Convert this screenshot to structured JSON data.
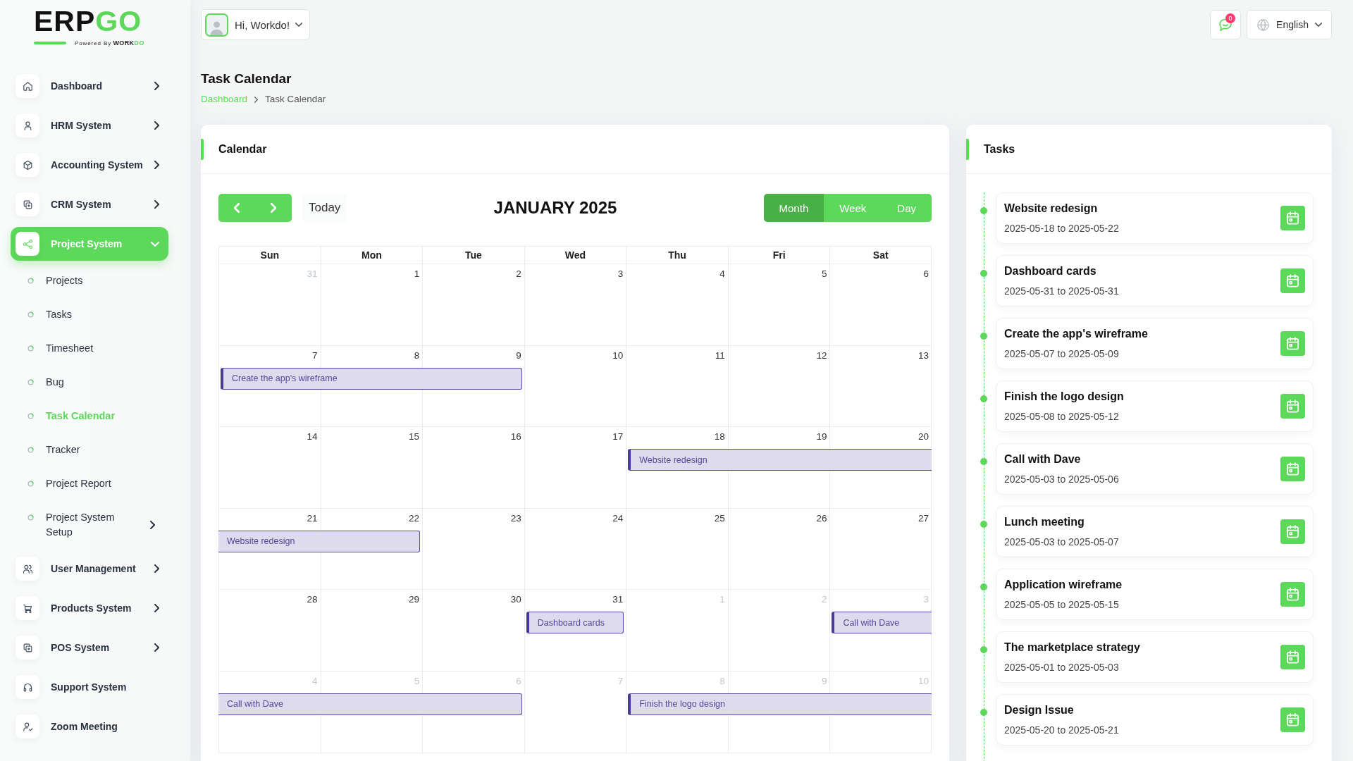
{
  "logo": {
    "name": "ERP",
    "name_accent": "GO",
    "tagline": "Powered By",
    "maker": "WORK",
    "maker_accent": "DO"
  },
  "header": {
    "user_menu": {
      "greeting": "Hi, Workdo!"
    },
    "notifications": {
      "count": "0"
    },
    "language": {
      "label": "English"
    }
  },
  "sidebar": {
    "items": [
      {
        "label": "Dashboard",
        "expanded": false,
        "selected": false
      },
      {
        "label": "HRM System",
        "expanded": false,
        "selected": false
      },
      {
        "label": "Accounting System",
        "expanded": false,
        "selected": false
      },
      {
        "label": "CRM System",
        "expanded": false,
        "selected": false
      },
      {
        "label": "Project System",
        "expanded": true,
        "selected": true,
        "children": [
          {
            "label": "Projects",
            "selected": false
          },
          {
            "label": "Tasks",
            "selected": false
          },
          {
            "label": "Timesheet",
            "selected": false
          },
          {
            "label": "Bug",
            "selected": false
          },
          {
            "label": "Task Calendar",
            "selected": true
          },
          {
            "label": "Tracker",
            "selected": false
          },
          {
            "label": "Project Report",
            "selected": false
          },
          {
            "label": "Project System Setup",
            "selected": false,
            "expanded": false
          }
        ]
      },
      {
        "label": "User Management",
        "expanded": false,
        "selected": false
      },
      {
        "label": "Products System",
        "expanded": false,
        "selected": false
      },
      {
        "label": "POS System",
        "expanded": false,
        "selected": false
      },
      {
        "label": "Support System",
        "selected": false
      },
      {
        "label": "Zoom Meeting",
        "selected": false
      }
    ]
  },
  "page": {
    "title": "Task Calendar",
    "breadcrumb": [
      {
        "label": "Dashboard",
        "current": false
      },
      {
        "label": "Task Calendar",
        "current": true
      }
    ]
  },
  "calendar": {
    "title": "Calendar",
    "today": "Today",
    "month": "JANUARY 2025",
    "views": [
      {
        "label": "Month",
        "selected": true
      },
      {
        "label": "Week",
        "selected": false
      },
      {
        "label": "Day",
        "selected": false
      }
    ],
    "weekdays": [
      "Sun",
      "Mon",
      "Tue",
      "Wed",
      "Thu",
      "Fri",
      "Sat"
    ],
    "weeks": [
      {
        "days": [
          {
            "date": "31",
            "other_month": true,
            "in_event": false
          },
          {
            "date": "1",
            "other_month": false,
            "in_event": false
          },
          {
            "date": "2",
            "other_month": false,
            "in_event": false
          },
          {
            "date": "3",
            "other_month": false,
            "in_event": false
          },
          {
            "date": "4",
            "other_month": false,
            "in_event": false
          },
          {
            "date": "5",
            "other_month": false,
            "in_event": false
          },
          {
            "date": "6",
            "other_month": false,
            "in_event": false
          }
        ]
      },
      {
        "days": [
          {
            "date": "7",
            "other_month": false,
            "in_event": true
          },
          {
            "date": "8",
            "other_month": false,
            "in_event": true
          },
          {
            "date": "9",
            "other_month": false,
            "in_event": true
          },
          {
            "date": "10",
            "other_month": false,
            "in_event": false
          },
          {
            "date": "11",
            "other_month": false,
            "in_event": false
          },
          {
            "date": "12",
            "other_month": false,
            "in_event": false
          },
          {
            "date": "13",
            "other_month": false,
            "in_event": false
          }
        ],
        "events": [
          {
            "title": "Create the app's wireframe",
            "starts": true,
            "ends": true
          }
        ]
      },
      {
        "days": [
          {
            "date": "14",
            "other_month": false,
            "in_event": false
          },
          {
            "date": "15",
            "other_month": false,
            "in_event": false
          },
          {
            "date": "16",
            "other_month": false,
            "in_event": false
          },
          {
            "date": "17",
            "other_month": false,
            "in_event": false
          },
          {
            "date": "18",
            "other_month": false,
            "in_event": true
          },
          {
            "date": "19",
            "other_month": false,
            "in_event": true
          },
          {
            "date": "20",
            "other_month": false,
            "in_event": true
          }
        ],
        "events": [
          {
            "title": "Website redesign",
            "starts": true,
            "ends": false
          }
        ]
      },
      {
        "days": [
          {
            "date": "21",
            "other_month": false,
            "in_event": true
          },
          {
            "date": "22",
            "other_month": false,
            "in_event": true
          },
          {
            "date": "23",
            "other_month": false,
            "in_event": false
          },
          {
            "date": "24",
            "other_month": false,
            "in_event": false
          },
          {
            "date": "25",
            "other_month": false,
            "in_event": false
          },
          {
            "date": "26",
            "other_month": false,
            "in_event": false
          },
          {
            "date": "27",
            "other_month": false,
            "in_event": false
          }
        ],
        "events": [
          {
            "title": "Website redesign",
            "starts": false,
            "ends": true
          }
        ]
      },
      {
        "days": [
          {
            "date": "28",
            "other_month": false,
            "in_event": false
          },
          {
            "date": "29",
            "other_month": false,
            "in_event": false
          },
          {
            "date": "30",
            "other_month": false,
            "in_event": false
          },
          {
            "date": "31",
            "other_month": false,
            "in_event": true
          },
          {
            "date": "1",
            "other_month": true,
            "in_event": false
          },
          {
            "date": "2",
            "other_month": true,
            "in_event": false
          },
          {
            "date": "3",
            "other_month": true,
            "in_event": true
          }
        ],
        "events": [
          {
            "title": "Dashboard cards",
            "starts": true,
            "ends": true
          },
          {
            "title": "Call with Dave",
            "starts": true,
            "ends": false
          }
        ]
      },
      {
        "days": [
          {
            "date": "4",
            "other_month": true,
            "in_event": true
          },
          {
            "date": "5",
            "other_month": true,
            "in_event": true
          },
          {
            "date": "6",
            "other_month": true,
            "in_event": true
          },
          {
            "date": "7",
            "other_month": true,
            "in_event": false
          },
          {
            "date": "8",
            "other_month": true,
            "in_event": true
          },
          {
            "date": "9",
            "other_month": true,
            "in_event": true
          },
          {
            "date": "10",
            "other_month": true,
            "in_event": true
          }
        ],
        "events": [
          {
            "title": "Call with Dave",
            "starts": false,
            "ends": true
          },
          {
            "title": "Finish the logo design",
            "starts": true,
            "ends": false
          }
        ]
      }
    ]
  },
  "tasks": {
    "title": "Tasks",
    "items": [
      {
        "title": "Website redesign",
        "dates": "2025-05-18 to 2025-05-22"
      },
      {
        "title": "Dashboard cards",
        "dates": "2025-05-31 to 2025-05-31"
      },
      {
        "title": "Create the app's wireframe",
        "dates": "2025-05-07 to 2025-05-09"
      },
      {
        "title": "Finish the logo design",
        "dates": "2025-05-08 to 2025-05-12"
      },
      {
        "title": "Call with Dave",
        "dates": "2025-05-03 to 2025-05-06"
      },
      {
        "title": "Lunch meeting",
        "dates": "2025-05-03 to 2025-05-07"
      },
      {
        "title": "Application wireframe",
        "dates": "2025-05-05 to 2025-05-15"
      },
      {
        "title": "The marketplace strategy",
        "dates": "2025-05-01 to 2025-05-03"
      },
      {
        "title": "Design Issue",
        "dates": "2025-05-20 to 2025-05-21"
      }
    ]
  }
}
